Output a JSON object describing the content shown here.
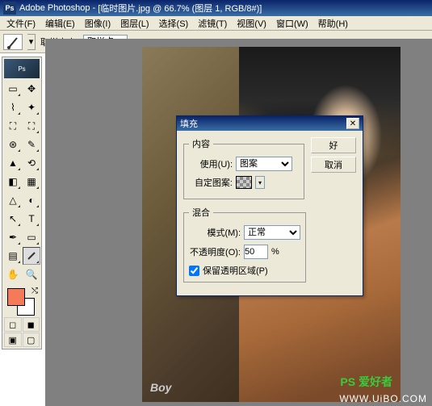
{
  "titlebar": {
    "app": "Adobe Photoshop",
    "doc": "[临时图片.jpg @ 66.7% (图层 1, RGB/8#)]"
  },
  "menu": {
    "file": "文件(F)",
    "edit": "编辑(E)",
    "image": "图像(I)",
    "layer": "图层(L)",
    "select": "选择(S)",
    "filter": "滤镜(T)",
    "view": "视图(V)",
    "window": "窗口(W)",
    "help": "帮助(H)"
  },
  "options": {
    "sample_size_label": "取样大小:",
    "sample_size_value": "取样点"
  },
  "tools": {
    "icons": [
      "▭",
      "▤",
      "⬚",
      "⊹",
      "✂",
      "✎",
      "✐",
      "⟁",
      "⟋",
      "◉",
      "◐",
      "△",
      "◧",
      "T",
      "↖",
      "⬜",
      "✋",
      "🔍",
      "…",
      "⋯"
    ]
  },
  "colors": {
    "foreground": "#f47a5a",
    "background": "#ffffff"
  },
  "dialog": {
    "title": "填充",
    "ok": "好",
    "cancel": "取消",
    "content_group": "内容",
    "use_label": "使用(U):",
    "use_value": "图案",
    "custom_pattern": "自定图案:",
    "blend_group": "混合",
    "mode_label": "模式(M):",
    "mode_value": "正常",
    "opacity_label": "不透明度(O):",
    "opacity_value": "50",
    "opacity_suffix": "%",
    "preserve": "保留透明区域(P)"
  },
  "canvas": {
    "logo_left": "Boy",
    "logo_right": "PS 爱好者",
    "watermark": "WWW.UiBO.COM"
  }
}
